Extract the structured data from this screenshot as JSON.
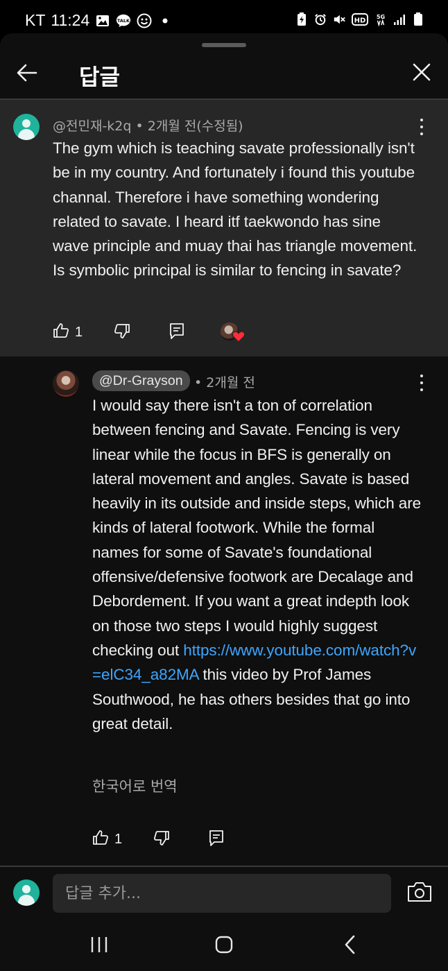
{
  "status_bar": {
    "carrier": "KT",
    "time": "11:24",
    "network_label": "5G",
    "hd_label": "HD"
  },
  "header": {
    "title": "답글"
  },
  "parent_comment": {
    "author": "@전민재-k2q",
    "age": "2개월 전(수정됨)",
    "separator": "•",
    "text": "The gym which is teaching savate professionally isn't be in my country. And fortunately i found this youtube channal. Therefore i have something wondering related to savate. I heard itf taekwondo has sine wave principle and muay thai has triangle movement. Is symbolic principal is similar to fencing in savate?",
    "likes": "1"
  },
  "reply": {
    "author": "@Dr-Grayson",
    "age": "2개월 전",
    "separator": "•",
    "text_before_link": "I would say there isn't a ton of correlation between fencing and Savate. Fencing is very linear while the focus in BFS is generally on lateral movement and angles. Savate is based heavily in its outside and inside steps, which are kinds of lateral footwork. While the formal names for some of Savate's foundational offensive/defensive footwork are Decalage and Debordement. If you want a great indepth look on those two steps I would highly suggest checking out ",
    "link": "https://www.youtube.com/watch?v=elC34_a82MA",
    "text_after_link": " this video by Prof James Southwood, he has others besides that go into great detail.",
    "translate": "한국어로 번역",
    "likes": "1"
  },
  "composer": {
    "placeholder": "답글 추가..."
  },
  "colors": {
    "background": "#0f0f0f",
    "highlight": "#272727",
    "link": "#3ea6ff",
    "heart": "#ff2d3a",
    "avatar": "#1fb39b"
  },
  "icons": [
    "back-arrow-icon",
    "close-icon",
    "more-vert-icon",
    "thumb-up-icon",
    "thumb-down-icon",
    "reply-icon",
    "creator-heart-icon",
    "camera-icon",
    "recent-apps-icon",
    "home-icon",
    "back-nav-icon"
  ]
}
